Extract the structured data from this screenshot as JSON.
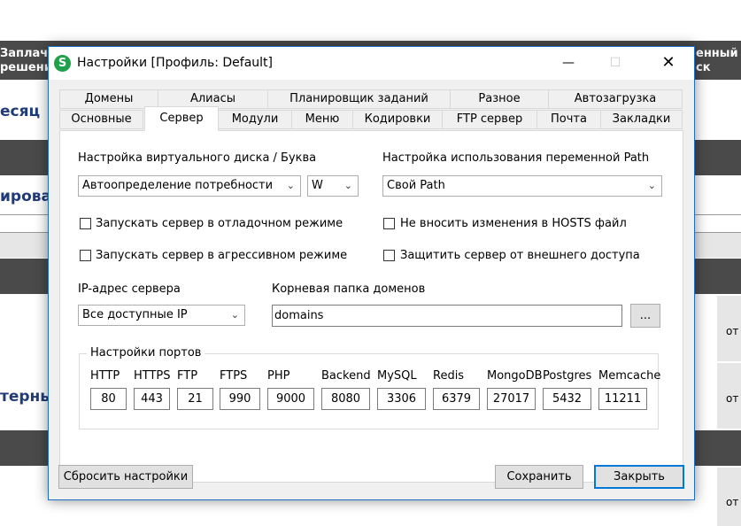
{
  "background": {
    "left_header_line1": "Заплачу",
    "left_header_line2": "решени",
    "right_header_line1": "енный",
    "right_header_line2": "ск",
    "side_text_1": "есяц",
    "side_text_2": "ирова",
    "side_text_3": "терны",
    "right_cell_text": "от"
  },
  "dialog": {
    "icon_letter": "S",
    "title": "Настройки [Профиль: Default]",
    "minimize_glyph": "—",
    "maximize_glyph": "☐",
    "close_glyph": "✕"
  },
  "tabs_row1": [
    "Домены",
    "Алиасы",
    "Планировщик заданий",
    "Разное",
    "Автозагрузка"
  ],
  "tabs_row2": [
    "Основные",
    "Сервер",
    "Модули",
    "Меню",
    "Кодировки",
    "FTP сервер",
    "Почта",
    "Закладки"
  ],
  "active_tab": "Сервер",
  "server": {
    "vdisk_label": "Настройка виртуального диска / Буква",
    "vdisk_value": "Автоопределение потребности",
    "letter_value": "W",
    "path_label": "Настройка использования переменной Path",
    "path_value": "Свой Path",
    "cb_debug": "Запускать сервер в отладочном режиме",
    "cb_aggressive": "Запускать сервер в агрессивном режиме",
    "cb_hosts": "Не вносить изменения в HOSTS файл",
    "cb_protect": "Защитить сервер от внешнего доступа",
    "ip_label": "IP-адрес сервера",
    "ip_value": "Все доступные IP",
    "root_label": "Корневая папка доменов",
    "root_value": "domains",
    "browse_label": "...",
    "ports_group_label": "Настройки портов",
    "ports": [
      {
        "name": "HTTP",
        "value": "80"
      },
      {
        "name": "HTTPS",
        "value": "443"
      },
      {
        "name": "FTP",
        "value": "21"
      },
      {
        "name": "FTPS",
        "value": "990"
      },
      {
        "name": "PHP",
        "value": "9000"
      },
      {
        "name": "Backend",
        "value": "8080"
      },
      {
        "name": "MySQL",
        "value": "3306"
      },
      {
        "name": "Redis",
        "value": "6379"
      },
      {
        "name": "MongoDB",
        "value": "27017"
      },
      {
        "name": "Postgres",
        "value": "5432"
      },
      {
        "name": "Memcache",
        "value": "11211"
      }
    ]
  },
  "buttons": {
    "reset": "Сбросить настройки",
    "save": "Сохранить",
    "close": "Закрыть"
  },
  "colors": {
    "accent": "#0078d7",
    "app_icon": "#1ea14a",
    "bg_band": "#4a4a4a"
  }
}
